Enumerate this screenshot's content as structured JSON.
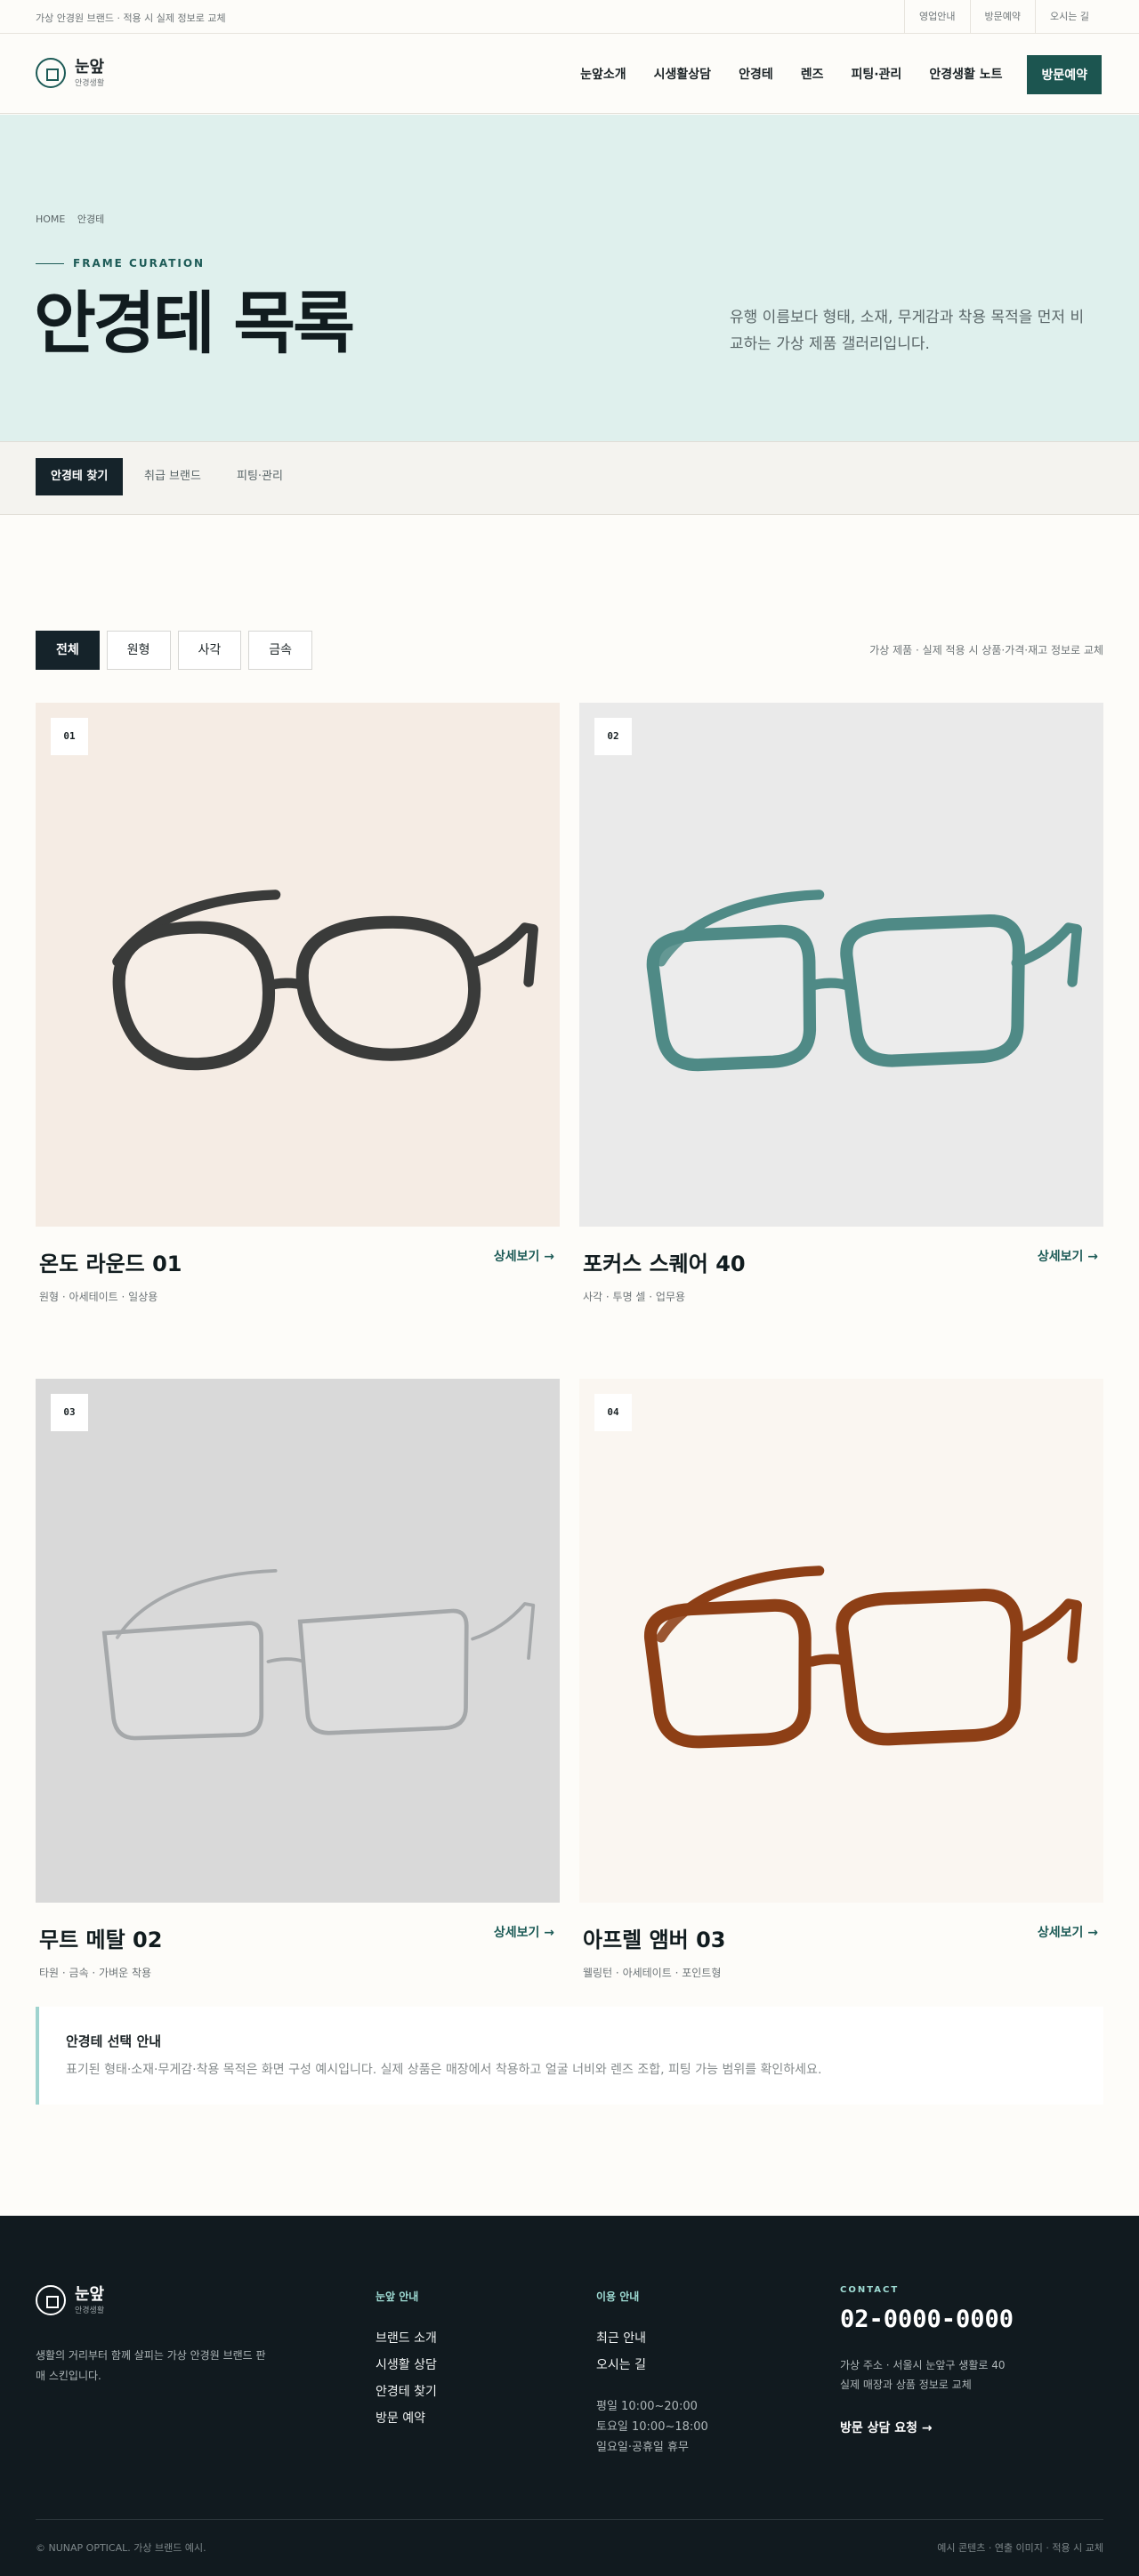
{
  "topbar": {
    "note": "가상 안경원 브랜드 · 적용 시 실제 정보로 교체",
    "links": [
      "영업안내",
      "방문예약",
      "오시는 길"
    ]
  },
  "header": {
    "logo_name": "눈앞",
    "logo_sub": "안경생활",
    "nav": [
      "눈앞소개",
      "시생활상담",
      "안경테",
      "렌즈",
      "피팅·관리",
      "안경생활 노트"
    ],
    "cta": "방문예약"
  },
  "hero": {
    "breadcrumb": [
      "HOME",
      "안경테"
    ],
    "eyebrow": "FRAME CURATION",
    "title": "안경테 목록",
    "desc": "유행 이름보다 형태, 소재, 무게감과 착용 목적을 먼저 비교하는 가상 제품 갤러리입니다."
  },
  "tabs": [
    "안경테 찾기",
    "취급 브랜드",
    "피팅·관리"
  ],
  "filters": {
    "options": [
      "전체",
      "원형",
      "사각",
      "금속"
    ],
    "selected": "전체",
    "note": "가상 제품 · 실제 적용 시 상품·가격·재고 정보로 교체"
  },
  "products": [
    {
      "no": "01",
      "name": "온도 라운드 01",
      "tags": "원형 · 아세테이트 · 일상용",
      "link": "상세보기 →",
      "bg": "#f5ece4",
      "frame": "#3a3b3a",
      "shape": "round"
    },
    {
      "no": "02",
      "name": "포커스 스퀘어 40",
      "tags": "사각 · 투명 셀 · 업무용",
      "link": "상세보기 →",
      "bg": "#eaeaea",
      "frame": "#4f8a86",
      "shape": "square"
    },
    {
      "no": "03",
      "name": "무트 메탈 02",
      "tags": "타원 · 금속 · 가벼운 착용",
      "link": "상세보기 →",
      "bg": "#d9d9d9",
      "frame": "#a5a8aa",
      "shape": "metal"
    },
    {
      "no": "04",
      "name": "아프렐 앰버 03",
      "tags": "웰링턴 · 아세테이트 · 포인트형",
      "link": "상세보기 →",
      "bg": "#faf6f1",
      "frame": "#8d3f16",
      "shape": "wellington"
    }
  ],
  "guide": {
    "title": "안경테 선택 안내",
    "text": "표기된 형태·소재·무게감·착용 목적은 화면 구성 예시입니다. 실제 상품은 매장에서 착용하고 얼굴 너비와 렌즈 조합, 피팅 가능 범위를 확인하세요."
  },
  "footer": {
    "logo_name": "눈앞",
    "logo_sub": "안경생활",
    "desc": "생활의 거리부터 함께 살피는 가상 안경원 브랜드 판매 스킨입니다.",
    "col1_title": "눈앞 안내",
    "col1_links": [
      "브랜드 소개",
      "시생활 상담",
      "안경테 찾기",
      "방문 예약"
    ],
    "col2_title": "이용 안내",
    "col2_links": [
      "최근 안내",
      "오시는 길"
    ],
    "hours": [
      "평일 10:00~20:00",
      "토요일 10:00~18:00",
      "일요일·공휴일 휴무"
    ],
    "contact_label": "CONTACT",
    "phone": "02-0000-0000",
    "address": [
      "가상 주소 · 서울시 눈앞구 생활로 40",
      "실제 매장과 상품 정보로 교체"
    ],
    "cta": "방문 상담 요청 →",
    "copyright": "© NUNAP OPTICAL. 가상 브랜드 예시.",
    "right": "예시 콘텐츠 · 연출 이미지 · 적용 시 교체"
  }
}
